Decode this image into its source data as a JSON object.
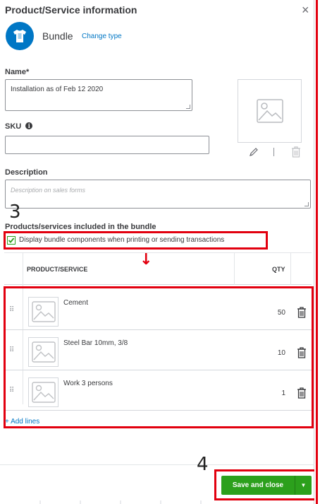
{
  "header": {
    "title": "Product/Service information",
    "close_glyph": "×"
  },
  "type": {
    "label": "Bundle",
    "change_link": "Change type",
    "icon": "shirt-icon",
    "accent": "#0077c5"
  },
  "name": {
    "label": "Name*",
    "value": "Installation as of Feb 12 2020"
  },
  "sku": {
    "label": "SKU",
    "value": ""
  },
  "description": {
    "label": "Description",
    "placeholder": "Description on sales forms"
  },
  "bundle": {
    "section_label": "Products/services included in the bundle",
    "checkbox_label": "Display bundle components when printing or sending transactions",
    "checked": true,
    "columns": {
      "product": "PRODUCT/SERVICE",
      "qty": "QTY"
    },
    "rows": [
      {
        "name": "Cement",
        "qty": "50"
      },
      {
        "name": "Steel Bar 10mm, 3/8",
        "qty": "10"
      },
      {
        "name": "Work 3 persons",
        "qty": "1"
      }
    ],
    "add_lines": "+ Add lines"
  },
  "annotations": {
    "step3": "3",
    "step4": "4",
    "arrow": "↓",
    "highlight_color": "#e2000f"
  },
  "footer": {
    "save_label": "Save and close",
    "save_color": "#2ca01c"
  }
}
